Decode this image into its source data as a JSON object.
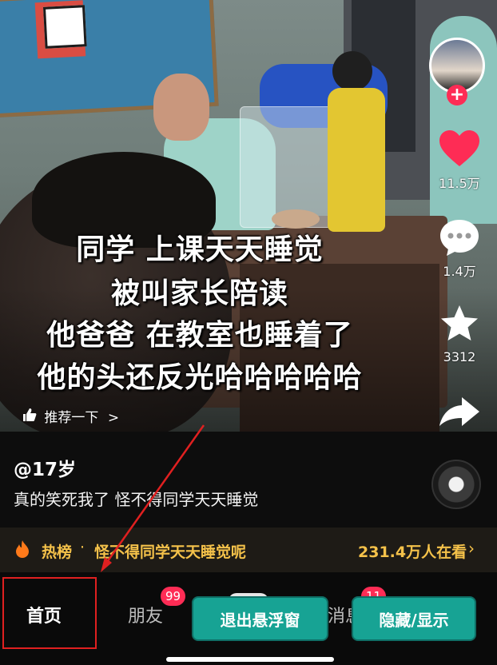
{
  "video": {
    "caption_lines": [
      "同学 上课天天睡觉",
      "被叫家长陪读",
      "他爸爸 在教室也睡着了",
      "他的头还反光哈哈哈哈哈"
    ],
    "recommend_label": "推荐一下",
    "recommend_chevron": ">"
  },
  "actions": {
    "follow_symbol": "+",
    "likes": "11.5万",
    "comments": "1.4万",
    "favorites": "3312"
  },
  "info": {
    "author": "@17岁",
    "description": "真的笑死我了 怪不得同学天天睡觉"
  },
  "hot": {
    "label": "热榜",
    "separator": "·",
    "topic": "怪不得同学天天睡觉呢",
    "viewers": "231.4万人在看",
    "chevron": "›"
  },
  "nav": {
    "home": "首页",
    "friends": "朋友",
    "friends_badge": "99",
    "messages": "消息",
    "messages_badge": "11"
  },
  "floating_buttons": {
    "exit_float": "退出悬浮窗",
    "hide_show": "隐藏/显示"
  },
  "colors": {
    "accent_red": "#fe2c55",
    "hot_yellow": "#f5c24a",
    "float_teal": "#17a394",
    "highlight_red": "#e02020"
  },
  "icons": [
    "heart-icon",
    "comment-icon",
    "star-icon",
    "share-icon",
    "thumbs-up-icon",
    "fire-icon",
    "music-disc-icon"
  ]
}
